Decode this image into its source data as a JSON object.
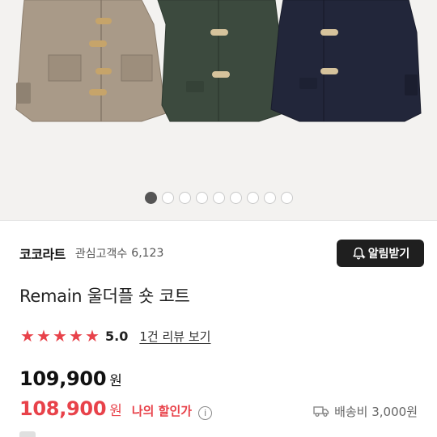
{
  "hero": {
    "image_alt": "duffle coat product photos in beige, dark green and navy",
    "coat_colors": [
      "#a99a88",
      "#3c4a3e",
      "#22263a"
    ],
    "dot_count": 9,
    "active_dot_index": 0
  },
  "seller": {
    "name": "코코라트",
    "favorite_label": "관심고객수",
    "favorite_count": "6,123",
    "alarm_button_label": "알림받기"
  },
  "product": {
    "title": "Remain 울더플 숏 코트"
  },
  "rating": {
    "stars": 5,
    "score": "5.0",
    "review_link": "1건 리뷰 보기"
  },
  "price": {
    "original": "109,900",
    "original_unit": "원",
    "discounted": "108,900",
    "discounted_unit": "원",
    "my_discount_label": "나의 할인가",
    "info_glyph": "i"
  },
  "shipping": {
    "label": "배송비 3,000원"
  },
  "colors": {
    "accent_red": "#e8424a",
    "dark_button": "#1f1f1f"
  }
}
